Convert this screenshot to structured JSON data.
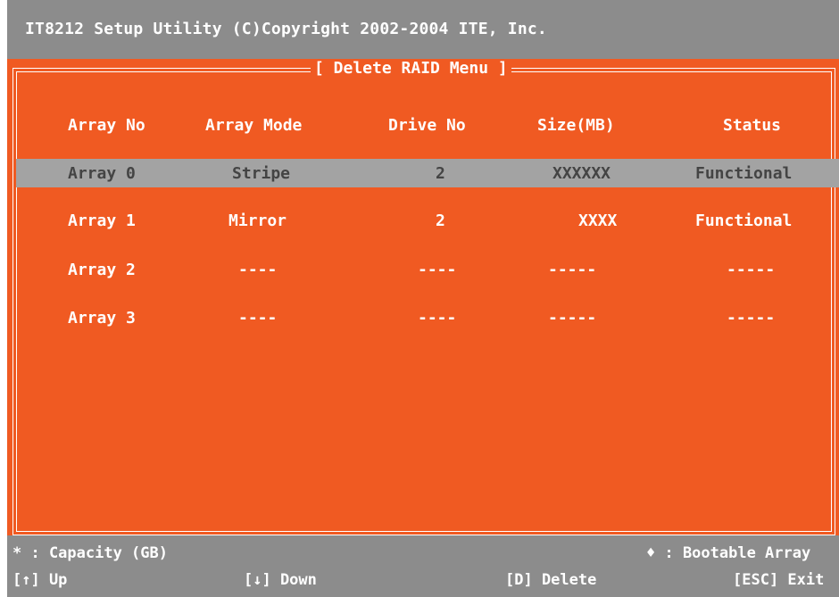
{
  "title": "IT8212 Setup Utility (C)Copyright 2002-2004 ITE, Inc.",
  "menu_title": "[ Delete RAID Menu ]",
  "columns": [
    "Array No",
    "Array Mode",
    "Drive No",
    "Size(MB)",
    "Status"
  ],
  "rows": [
    {
      "array": "Array 0",
      "mode": "Stripe",
      "drives": "2",
      "size": "XXXXXX",
      "status": "Functional"
    },
    {
      "array": "Array 1",
      "mode": "Mirror",
      "drives": "2",
      "size": "XXXX",
      "status": "Functional"
    },
    {
      "array": "Array 2",
      "mode": "----",
      "drives": "----",
      "size": "-----",
      "status": "-----"
    },
    {
      "array": "Array 3",
      "mode": "----",
      "drives": "----",
      "size": "-----",
      "status": "-----"
    }
  ],
  "selected_row": "Array 0",
  "legend": {
    "capacity": "* : Capacity (GB)",
    "bootable": "♦ : Bootable Array"
  },
  "keys": {
    "up": "[↑] Up",
    "down": "[↓] Down",
    "delete": "[D] Delete",
    "exit": "[ESC] Exit"
  },
  "colors": {
    "background": "#f05a22",
    "bars": "#8c8c8c",
    "selection": "#a3a3a3"
  }
}
